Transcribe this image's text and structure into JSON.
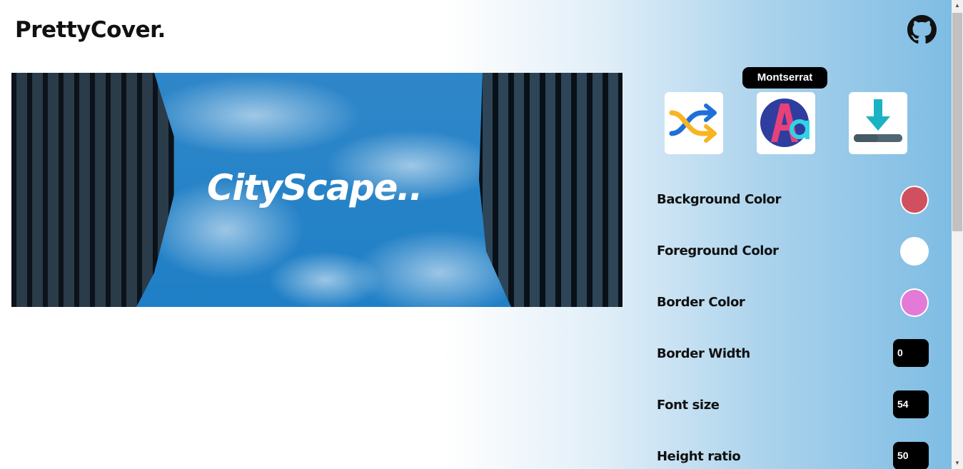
{
  "app": {
    "logo": "PrettyCover."
  },
  "cover": {
    "title": "CityScape.."
  },
  "toolbar": {
    "tooltip": "Montserrat",
    "buttons": [
      {
        "name": "shuffle",
        "icon": "shuffle-icon"
      },
      {
        "name": "font",
        "icon": "font-aa-icon"
      },
      {
        "name": "download",
        "icon": "download-icon"
      }
    ]
  },
  "settings": {
    "background_color": {
      "label": "Background Color",
      "value": "#d1505f"
    },
    "foreground_color": {
      "label": "Foreground Color",
      "value": "#ffffff"
    },
    "border_color": {
      "label": "Border Color",
      "value": "#e47ad7"
    },
    "border_width": {
      "label": "Border Width",
      "value": "0"
    },
    "font_size": {
      "label": "Font size",
      "value": "54"
    },
    "height_ratio": {
      "label": "Height ratio",
      "value": "50"
    }
  }
}
